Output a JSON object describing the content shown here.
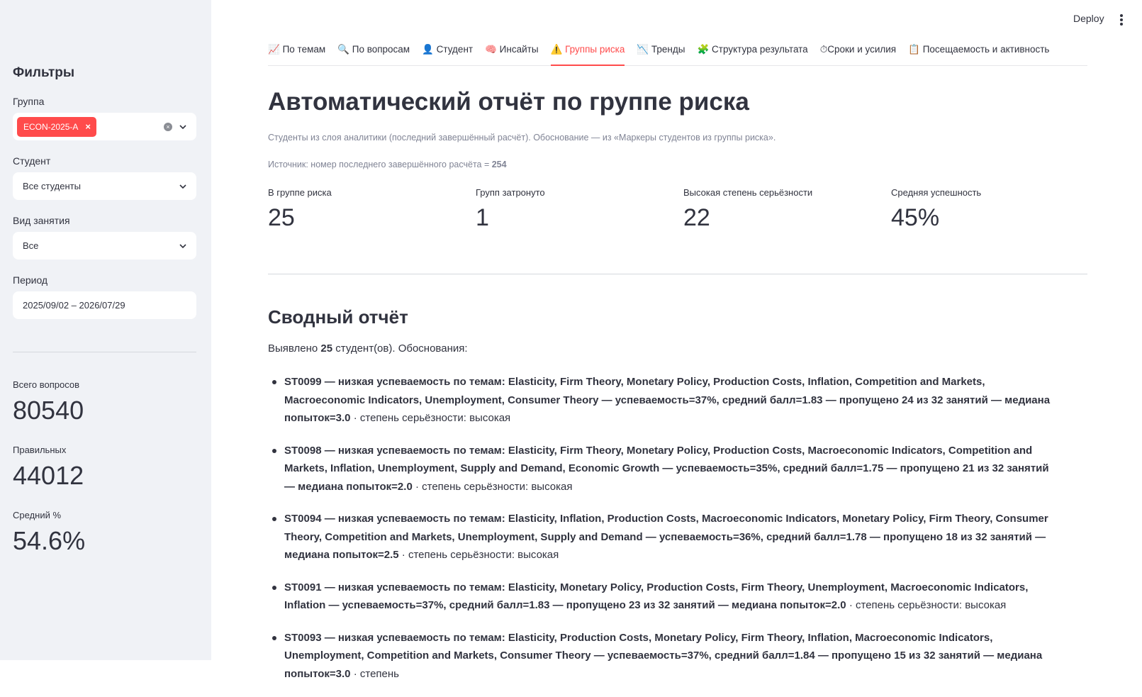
{
  "sidebar": {
    "title": "Фильтры",
    "group_label": "Группа",
    "group_tag": "ECON-2025-A",
    "student_label": "Студент",
    "student_value": "Все студенты",
    "lesson_label": "Вид занятия",
    "lesson_value": "Все",
    "period_label": "Период",
    "period_value": "2025/09/02 – 2026/07/29",
    "metrics": [
      {
        "label": "Всего вопросов",
        "value": "80540"
      },
      {
        "label": "Правильных",
        "value": "44012"
      },
      {
        "label": "Средний %",
        "value": "54.6%"
      }
    ]
  },
  "header": {
    "deploy_label": "Deploy"
  },
  "tabs": [
    {
      "icon": "📈",
      "label": "По темам"
    },
    {
      "icon": "🔍",
      "label": "По вопросам"
    },
    {
      "icon": "👤",
      "label": "Студент"
    },
    {
      "icon": "🧠",
      "label": "Инсайты"
    },
    {
      "icon": "⚠️",
      "label": "Группы риска"
    },
    {
      "icon": "📉",
      "label": "Тренды"
    },
    {
      "icon": "🧩",
      "label": "Структура результата"
    },
    {
      "icon": "⏱",
      "label": "Сроки и усилия"
    },
    {
      "icon": "📋",
      "label": "Посещаемость и активность"
    }
  ],
  "main": {
    "title": "Автоматический отчёт по группе риска",
    "caption1": "Студенты из слоя аналитики (последний завершённый расчёт). Обоснование — из «Маркеры студентов из группы риска».",
    "caption2_prefix": "Источник: номер последнего завершённого расчёта = ",
    "caption2_value": "254",
    "metrics": [
      {
        "label": "В группе риска",
        "value": "25"
      },
      {
        "label": "Групп затронуто",
        "value": "1"
      },
      {
        "label": "Высокая степень серьёзности",
        "value": "22"
      },
      {
        "label": "Средняя успешность",
        "value": "45%"
      }
    ],
    "summary_title": "Сводный отчёт",
    "summary_prefix": "Выявлено ",
    "summary_count": "25",
    "summary_suffix": " студент(ов). Обоснования:",
    "items": [
      {
        "bold": "ST0099 — низкая успеваемость по темам: Elasticity, Firm Theory, Monetary Policy, Production Costs, Inflation, Competition and Markets, Macroeconomic Indicators, Unemployment, Consumer Theory — успеваемость=37%, средний балл=1.83 — пропущено 24 из 32 занятий — медиана попыток=3.0",
        "rest": " · степень серьёзности: высокая"
      },
      {
        "bold": "ST0098 — низкая успеваемость по темам: Elasticity, Firm Theory, Monetary Policy, Production Costs, Macroeconomic Indicators, Competition and Markets, Inflation, Unemployment, Supply and Demand, Economic Growth — успеваемость=35%, средний балл=1.75 — пропущено 21 из 32 занятий — медиана попыток=2.0",
        "rest": " · степень серьёзности: высокая"
      },
      {
        "bold": "ST0094 — низкая успеваемость по темам: Elasticity, Inflation, Production Costs, Macroeconomic Indicators, Monetary Policy, Firm Theory, Consumer Theory, Competition and Markets, Unemployment, Supply and Demand — успеваемость=36%, средний балл=1.78 — пропущено 18 из 32 занятий — медиана попыток=2.5",
        "rest": " · степень серьёзности: высокая"
      },
      {
        "bold": "ST0091 — низкая успеваемость по темам: Elasticity, Monetary Policy, Production Costs, Firm Theory, Unemployment, Macroeconomic Indicators, Inflation — успеваемость=37%, средний балл=1.83 — пропущено 23 из 32 занятий — медиана попыток=2.0",
        "rest": " · степень серьёзности: высокая"
      },
      {
        "bold": "ST0093 — низкая успеваемость по темам: Elasticity, Production Costs, Monetary Policy, Firm Theory, Inflation, Macroeconomic Indicators, Unemployment, Competition and Markets, Consumer Theory — успеваемость=37%, средний балл=1.84 — пропущено 15 из 32 занятий — медиана попыток=3.0",
        "rest": " · степень"
      }
    ]
  }
}
